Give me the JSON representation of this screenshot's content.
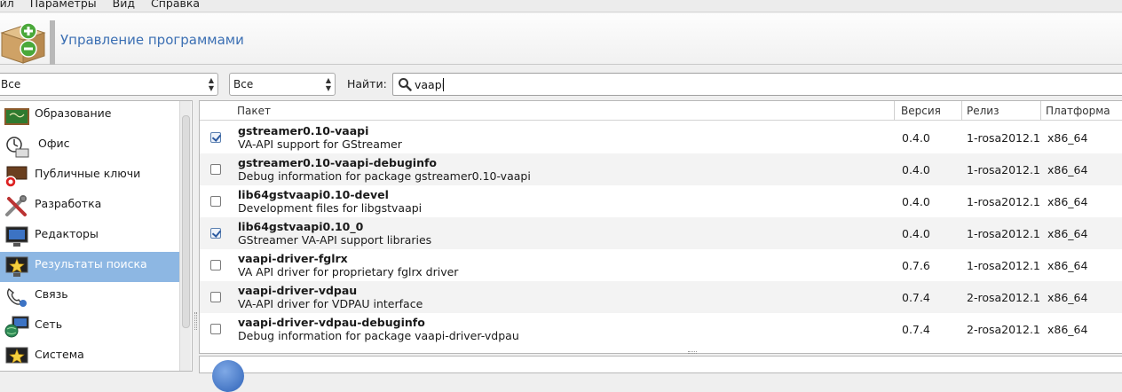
{
  "menubar": {
    "items": [
      "Файл",
      "Параметры",
      "Вид",
      "Справка"
    ],
    "visible_first": "айл"
  },
  "header": {
    "title": "Управление программами",
    "logo_icon": "package-add-remove-icon"
  },
  "filters": {
    "combo1_value": "Все",
    "combo2_value": "Все",
    "find_label": "Найти:",
    "search_value": "vaapi"
  },
  "sidebar": {
    "selected_index": 5,
    "items": [
      {
        "label": "Образование",
        "icon": "education-icon"
      },
      {
        "label": "Офис",
        "icon": "office-icon"
      },
      {
        "label": "Публичные ключи",
        "icon": "public-keys-icon"
      },
      {
        "label": "Разработка",
        "icon": "development-icon"
      },
      {
        "label": "Редакторы",
        "icon": "editors-icon"
      },
      {
        "label": "Результаты поиска",
        "icon": "search-results-icon"
      },
      {
        "label": "Связь",
        "icon": "communication-icon"
      },
      {
        "label": "Сеть",
        "icon": "network-icon"
      },
      {
        "label": "Система",
        "icon": "system-icon"
      }
    ]
  },
  "table": {
    "headers": {
      "package": "Пакет",
      "version": "Версия",
      "release": "Релиз",
      "platform": "Платформа"
    },
    "rows": [
      {
        "checked": true,
        "name": "gstreamer0.10-vaapi",
        "desc": "VA-API support for GStreamer",
        "version": "0.4.0",
        "release": "1-rosa2012.1",
        "platform": "x86_64"
      },
      {
        "checked": false,
        "name": "gstreamer0.10-vaapi-debuginfo",
        "desc": "Debug information for package gstreamer0.10-vaapi",
        "version": "0.4.0",
        "release": "1-rosa2012.1",
        "platform": "x86_64"
      },
      {
        "checked": false,
        "name": "lib64gstvaapi0.10-devel",
        "desc": "Development files for libgstvaapi",
        "version": "0.4.0",
        "release": "1-rosa2012.1",
        "platform": "x86_64"
      },
      {
        "checked": true,
        "name": "lib64gstvaapi0.10_0",
        "desc": "GStreamer VA-API support libraries",
        "version": "0.4.0",
        "release": "1-rosa2012.1",
        "platform": "x86_64"
      },
      {
        "checked": false,
        "name": "vaapi-driver-fglrx",
        "desc": "VA API driver for proprietary fglrx driver",
        "version": "0.7.6",
        "release": "1-rosa2012.1",
        "platform": "x86_64"
      },
      {
        "checked": false,
        "name": "vaapi-driver-vdpau",
        "desc": "VA-API driver for VDPAU interface",
        "version": "0.7.4",
        "release": "2-rosa2012.1",
        "platform": "x86_64"
      },
      {
        "checked": false,
        "name": "vaapi-driver-vdpau-debuginfo",
        "desc": "Debug information for package vaapi-driver-vdpau",
        "version": "0.7.4",
        "release": "2-rosa2012.1",
        "platform": "x86_64"
      }
    ]
  }
}
